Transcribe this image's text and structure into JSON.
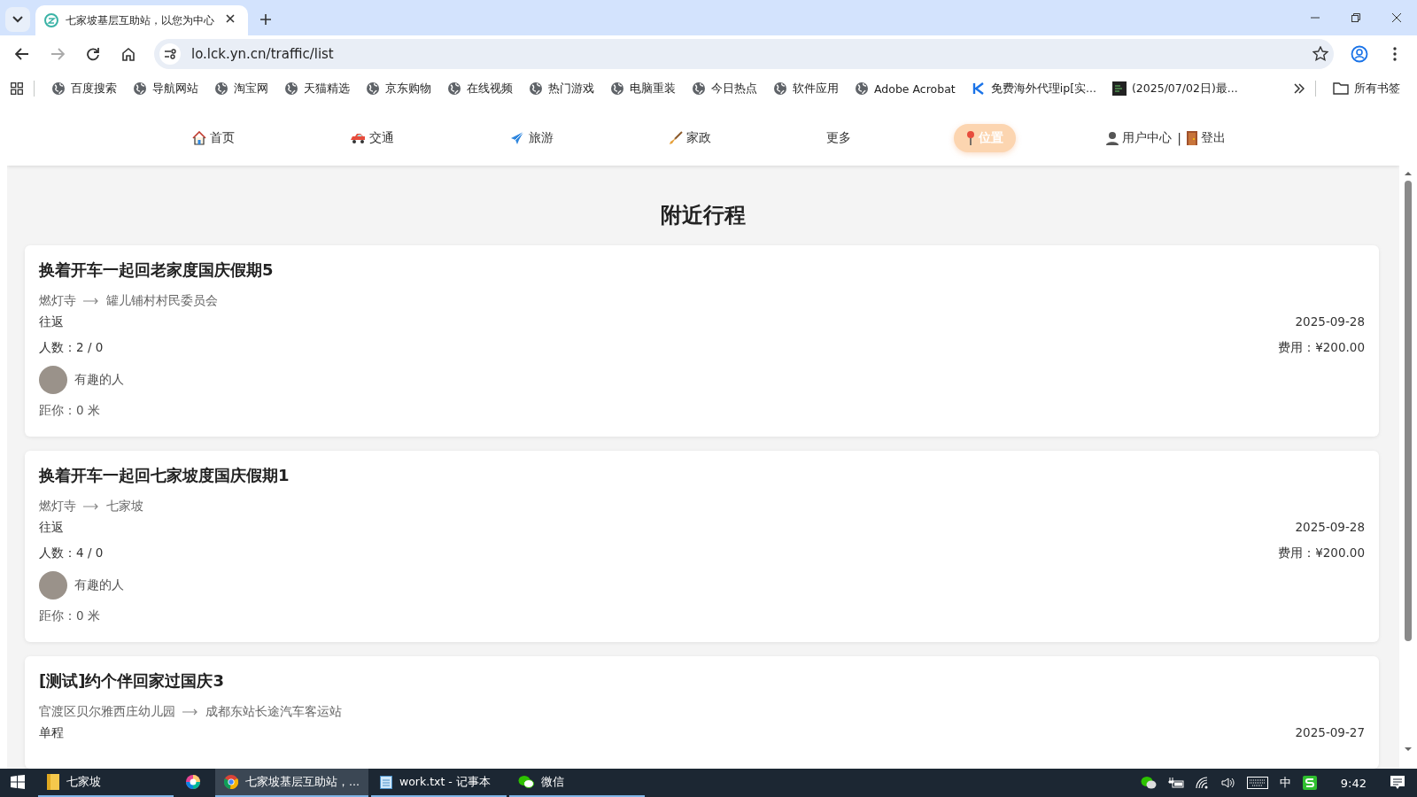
{
  "browser": {
    "tab_title": "七家坡基层互助站，以您为中心",
    "url": "lo.lck.yn.cn/traffic/list",
    "bookmarks": [
      {
        "label": "百度搜索",
        "kind": "globe"
      },
      {
        "label": "导航网站",
        "kind": "globe"
      },
      {
        "label": "淘宝网",
        "kind": "globe"
      },
      {
        "label": "天猫精选",
        "kind": "globe"
      },
      {
        "label": "京东购物",
        "kind": "globe"
      },
      {
        "label": "在线视频",
        "kind": "globe"
      },
      {
        "label": "热门游戏",
        "kind": "globe"
      },
      {
        "label": "电脑重装",
        "kind": "globe"
      },
      {
        "label": "今日热点",
        "kind": "globe"
      },
      {
        "label": "软件应用",
        "kind": "globe"
      },
      {
        "label": "Adobe Acrobat",
        "kind": "globe"
      },
      {
        "label": "免费海外代理ip[实...",
        "kind": "k"
      },
      {
        "label": "(2025/07/02日)最...",
        "kind": "doc"
      }
    ],
    "all_bookmarks": "所有书签"
  },
  "nav": {
    "items": [
      {
        "label": "首页",
        "kind": "home",
        "selected": false
      },
      {
        "label": "交通",
        "kind": "car",
        "selected": false
      },
      {
        "label": "旅游",
        "kind": "plane",
        "selected": false
      },
      {
        "label": "家政",
        "kind": "broom",
        "selected": false
      },
      {
        "label": "更多",
        "kind": "text",
        "selected": false
      },
      {
        "label": "位置",
        "kind": "pin",
        "selected": true
      }
    ],
    "user_center": "用户中心",
    "separator": "|",
    "logout": "登出"
  },
  "heading": "附近行程",
  "trips": [
    {
      "title": "换着开车一起回老家度国庆假期5",
      "from": "燃灯寺",
      "to": "罐儿铺村村民委员会",
      "type": "往返",
      "date": "2025-09-28",
      "people": "人数：2 / 0",
      "fee": "费用：¥200.00",
      "user": "有趣的人",
      "distance": "距你：0 米"
    },
    {
      "title": "换着开车一起回七家坡度国庆假期1",
      "from": "燃灯寺",
      "to": "七家坡",
      "type": "往返",
      "date": "2025-09-28",
      "people": "人数：4 / 0",
      "fee": "费用：¥200.00",
      "user": "有趣的人",
      "distance": "距你：0 米"
    },
    {
      "title": "[测试]约个伴回家过国庆3",
      "from": "官渡区贝尔雅西庄幼儿园",
      "to": "成都东站长途汽车客运站",
      "type": "单程",
      "date": "2025-09-27"
    }
  ],
  "taskbar": {
    "items": [
      {
        "kind": "folder",
        "label": "七家坡",
        "active": false
      },
      {
        "kind": "colorwheel"
      },
      {
        "kind": "chrome",
        "label": "七家坡基层互助站，...",
        "active": true
      },
      {
        "kind": "notepad",
        "label": "work.txt - 记事本",
        "active": false
      },
      {
        "kind": "wechat",
        "label": "微信",
        "active": false
      }
    ],
    "ime": "中",
    "time": "9:42"
  }
}
